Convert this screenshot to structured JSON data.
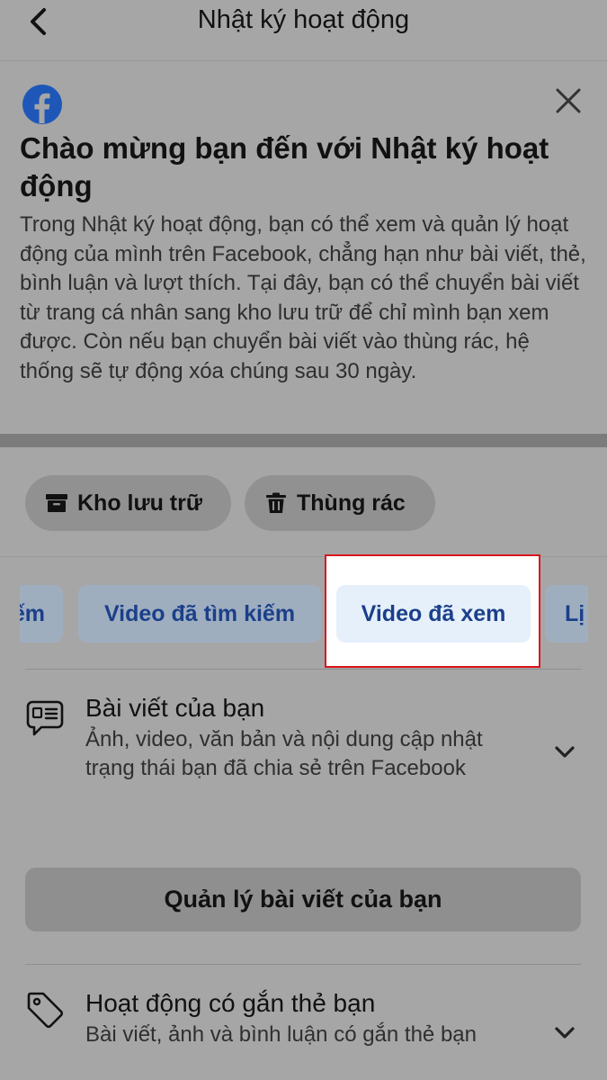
{
  "header": {
    "title": "Nhật ký hoạt động",
    "back_icon": "chevron-left-icon"
  },
  "welcome": {
    "logo_icon": "facebook-logo-icon",
    "title": "Chào mừng bạn đến với Nhật ký hoạt động",
    "description": "Trong Nhật ký hoạt động, bạn có thể xem và quản lý hoạt động của mình trên Facebook, chẳng hạn như bài viết, thẻ, bình luận và lượt thích. Tại đây, bạn có thể chuyển bài viết từ trang cá nhân sang kho lưu trữ để chỉ mình bạn xem được. Còn nếu bạn chuyển bài viết vào thùng rác, hệ thống sẽ tự động xóa chúng sau 30 ngày.",
    "close_icon": "close-icon"
  },
  "quick_actions": [
    {
      "label": "Kho lưu trữ",
      "icon": "archive-icon"
    },
    {
      "label": "Thùng rác",
      "icon": "trash-icon"
    }
  ],
  "filter_chips": [
    {
      "label": "ếm"
    },
    {
      "label": "Video đã tìm kiếm"
    },
    {
      "label": "Video đã xem"
    },
    {
      "label": "Lị"
    }
  ],
  "colors": {
    "highlight_border": "#d8141c",
    "chip_text": "#1b3f8a",
    "facebook_blue": "#1e57b8"
  },
  "sections": [
    {
      "title": "Bài viết của bạn",
      "description": "Ảnh, video, văn bản và nội dung cập nhật trạng thái bạn đã chia sẻ trên Facebook",
      "icon": "post-bubble-icon",
      "button_label": "Quản lý bài viết của bạn"
    },
    {
      "title": "Hoạt động có gắn thẻ bạn",
      "description": "Bài viết, ảnh và bình luận có gắn thẻ bạn",
      "icon": "tag-icon"
    }
  ]
}
